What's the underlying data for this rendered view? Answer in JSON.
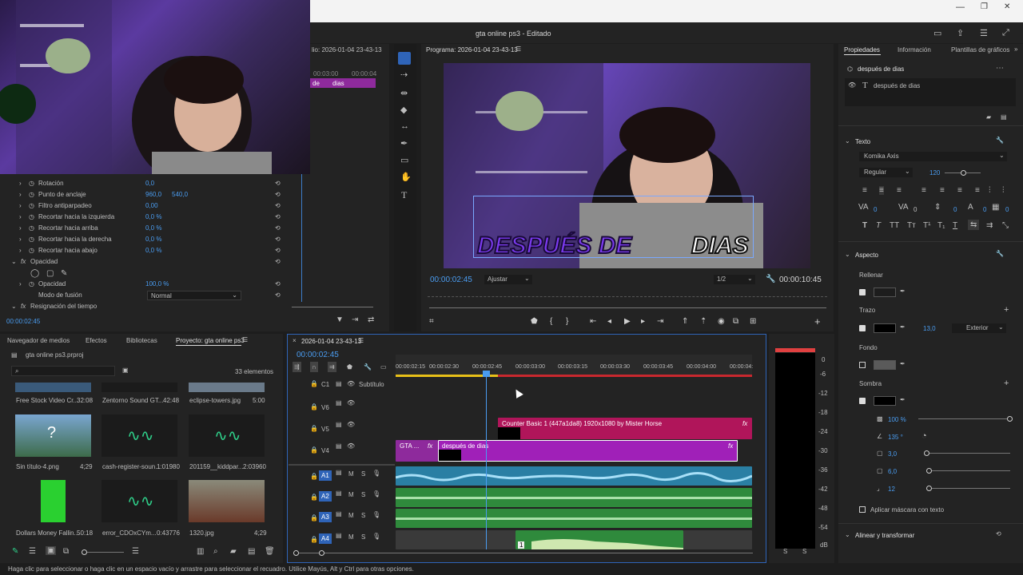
{
  "window": {
    "title": "gta online ps3 - Editado",
    "min": "—",
    "max": "❐",
    "close": "✕"
  },
  "source_panel": {
    "title": "lio: 2026-01-04 23-43-13",
    "tc": "00:03:00",
    "tc2": "00:00:04",
    "clip_a": "de",
    "clip_b": "dias"
  },
  "effect_controls": {
    "rows": [
      {
        "label": "Rotación",
        "v1": "0,0",
        "v2": ""
      },
      {
        "label": "Punto de anclaje",
        "v1": "960,0",
        "v2": "540,0"
      },
      {
        "label": "Filtro antiparpadeo",
        "v1": "0,00",
        "v2": ""
      },
      {
        "label": "Recortar hacia la izquierda",
        "v1": "0,0 %",
        "v2": ""
      },
      {
        "label": "Recortar hacia arriba",
        "v1": "0,0 %",
        "v2": ""
      },
      {
        "label": "Recortar hacia la derecha",
        "v1": "0,0 %",
        "v2": ""
      },
      {
        "label": "Recortar hacia abajo",
        "v1": "0,0 %",
        "v2": ""
      }
    ],
    "opacity_section": "Opacidad",
    "opacity_label": "Opacidad",
    "opacity_value": "100,0 %",
    "blend_label": "Modo de fusión",
    "blend_value": "Normal",
    "time_remap": "Resignación del tiempo",
    "timecode": "00:00:02:45"
  },
  "program": {
    "title": "Programa: 2026-01-04 23-43-13",
    "timecode": "00:00:02:45",
    "fit": "Ajustar",
    "ratio": "1/2",
    "duration": "00:00:10:45",
    "caption_left": "DESPUÉS DE",
    "caption_right": "DIAS"
  },
  "properties": {
    "tabs": [
      "Propiedades",
      "Información",
      "Plantillas de gráficos"
    ],
    "layer_title": "después de        dias",
    "layer_item": "después de        dias",
    "text_section": "Texto",
    "font": "Komika Axis",
    "style": "Regular",
    "size": "120",
    "nums": [
      "0",
      "0",
      "0",
      "0",
      "0"
    ],
    "aspect_section": "Aspecto",
    "fill": "Rellenar",
    "stroke": "Trazo",
    "stroke_w": "13,0",
    "stroke_pos": "Exterior",
    "bg": "Fondo",
    "shadow": "Sombra",
    "opacity": "100 %",
    "angle": "135 °",
    "distance": "3,0",
    "size2": "6,0",
    "blur": "12",
    "mask": "Aplicar máscara con texto",
    "align": "Alinear y transformar"
  },
  "project": {
    "tabs": [
      "Navegador de medios",
      "Efectos",
      "Bibliotecas",
      "Proyecto: gta online ps3"
    ],
    "file": "gta online ps3.prproj",
    "count": "33 elementos",
    "items": [
      {
        "name": "Free Stock Video Cr...",
        "dur": "32:08"
      },
      {
        "name": "Zentorno Sound GT...",
        "dur": "42:48"
      },
      {
        "name": "eclipse-towers.jpg",
        "dur": "5:00"
      },
      {
        "name": "Sin título-4.png",
        "dur": "4;29"
      },
      {
        "name": "cash-register-soun...",
        "dur": "1:01980"
      },
      {
        "name": "201159__kiddpar...",
        "dur": "2:03960"
      },
      {
        "name": "Dollars Money Fallin...",
        "dur": "50:18"
      },
      {
        "name": "error_CDOxCYm...",
        "dur": "0:43776"
      },
      {
        "name": "1320.jpg",
        "dur": "4;29"
      }
    ]
  },
  "timeline": {
    "title": "2026-01-04 23-43-13",
    "timecode": "00:00:02:45",
    "ruler": [
      "00:00:02:15",
      "00:00:02:30",
      "00:00:02:45",
      "00:00:03:00",
      "00:00:03:15",
      "00:00:03:30",
      "00:00:03:45",
      "00:00:04:00",
      "00:00:04:"
    ],
    "tracks": [
      "C1",
      "V6",
      "V5",
      "V4",
      "A1",
      "A2",
      "A3",
      "A4"
    ],
    "subtitle": "Subtítulo",
    "clip_v5": "Counter Basic 1 (447a1da8) 1920x1080 by Mister Horse",
    "clip_v4a": "GTA ...",
    "clip_v4b": "después de        dias",
    "a4_num": "1"
  },
  "meter": {
    "ticks": [
      "0",
      "-6",
      "-12",
      "-18",
      "-24",
      "-30",
      "-36",
      "-42",
      "-48",
      "-54",
      "dB"
    ],
    "s1": "S",
    "s2": "S"
  },
  "status": "Haga clic para seleccionar o haga clic en un espacio vacío y arrastre para seleccionar el recuadro. Utilice Mayús, Alt y Ctrl para otras opciones."
}
